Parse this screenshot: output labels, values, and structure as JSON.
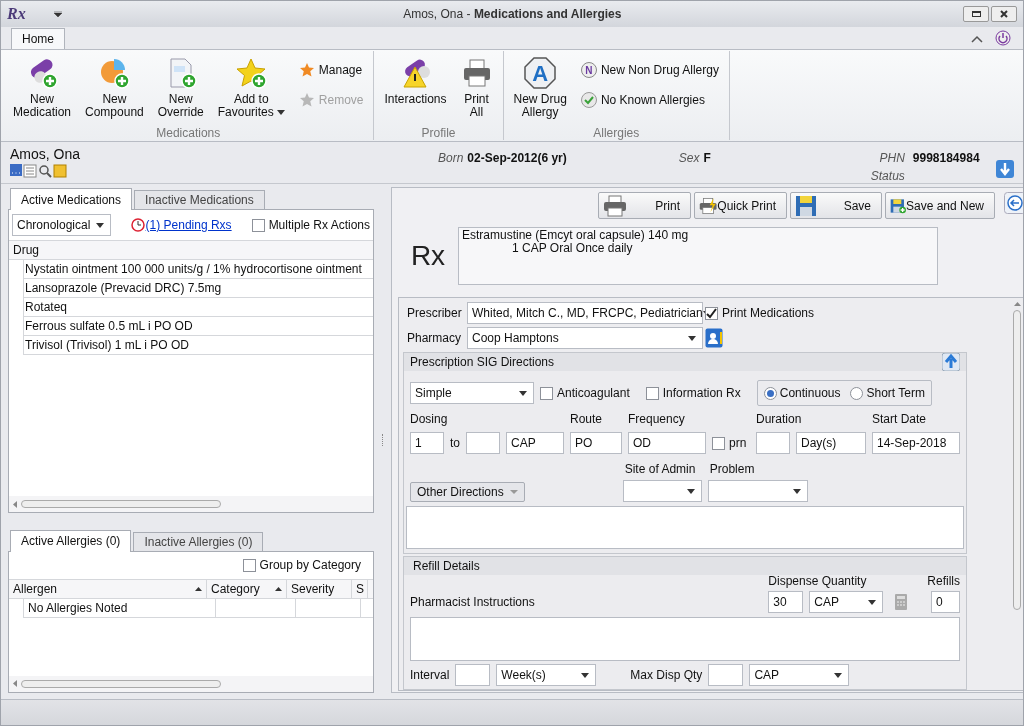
{
  "window": {
    "logo": "Rx",
    "title": "Amos, Ona - **Medications and Allergies**"
  },
  "ribbon": {
    "tabs": [
      {
        "label": "Home",
        "selected": true
      }
    ],
    "groups": [
      {
        "label": "Medications",
        "items": [
          {
            "kind": "large",
            "lines": [
              "New",
              "Medication"
            ]
          },
          {
            "kind": "large",
            "lines": [
              "New",
              "Compound"
            ]
          },
          {
            "kind": "large",
            "lines": [
              "New",
              "Override"
            ]
          },
          {
            "kind": "large",
            "lines": [
              "Add to",
              "Favourites"
            ],
            "dropdown": true
          },
          {
            "kind": "small",
            "label": "Manage",
            "disabled": false
          },
          {
            "kind": "small",
            "label": "Remove",
            "disabled": true
          }
        ]
      },
      {
        "label": "Profile",
        "items": [
          {
            "kind": "large",
            "lines": [
              "Interactions"
            ]
          },
          {
            "kind": "large",
            "lines": [
              "Print",
              "All"
            ]
          }
        ]
      },
      {
        "label": "Allergies",
        "items": [
          {
            "kind": "large",
            "lines": [
              "New Drug",
              "Allergy"
            ],
            "badge": "A"
          },
          {
            "kind": "small",
            "label": "New Non Drug Allergy",
            "badge": "N",
            "disabled": false
          },
          {
            "kind": "small",
            "label": "No Known Allergies",
            "disabled": false
          }
        ]
      }
    ]
  },
  "patient": {
    "name": "Amos, Ona",
    "born_label": "Born",
    "born": "02-Sep-2012(6 yr)",
    "sex_label": "Sex",
    "sex": "F",
    "phn_label": "PHN",
    "phn": "9998184984",
    "status_label": "Status"
  },
  "medications": {
    "tabs": [
      {
        "label": "Active Medications",
        "selected": true
      },
      {
        "label": "Inactive Medications",
        "selected": false
      }
    ],
    "sort": "Chronological",
    "pending_link": "(1) Pending Rxs",
    "multiple_rx": {
      "label": "Multiple Rx Actions",
      "checked": false
    },
    "columns": [
      "Drug"
    ],
    "rows": [
      "Nystatin ointment 100 000 units/g / 1% hydrocortisone ointment",
      "Lansoprazole (Prevacid DRC) 7.5mg",
      "Rotateq",
      "Ferrous sulfate 0.5 mL i PO OD",
      "Trivisol (Trivisol) 1 mL i PO OD"
    ]
  },
  "allergies": {
    "tabs": [
      {
        "label": "Active Allergies (0)",
        "selected": true
      },
      {
        "label": "Inactive Allergies (0)",
        "selected": false
      }
    ],
    "group_by": {
      "label": "Group by Category",
      "checked": false
    },
    "columns": [
      {
        "label": "Allergen",
        "sorted": true
      },
      {
        "label": "Category",
        "sorted": true
      },
      {
        "label": "Severity"
      },
      {
        "label": "S"
      }
    ],
    "rows": [
      {
        "allergen": "No Allergies Noted"
      }
    ]
  },
  "rx": {
    "toolbar": [
      {
        "label": "Print"
      },
      {
        "label": "Quick Print"
      },
      {
        "label": "Save"
      },
      {
        "label": "Save and New"
      }
    ],
    "logo": "Rx",
    "lines": [
      "Estramustine (Emcyt oral capsule) 140 mg",
      "1 CAP Oral Once daily"
    ],
    "prescriber_label": "Prescriber",
    "prescriber": "Whited, Mitch C., MD, FRCPC, Pediatrician",
    "print_medications": {
      "label": "Print Medications",
      "checked": true
    },
    "pharmacy_label": "Pharmacy",
    "pharmacy": "Coop Hamptons",
    "sig": {
      "title": "Prescription SIG Directions",
      "type": "Simple",
      "checks": [
        {
          "label": "Anticoagulant",
          "checked": false
        },
        {
          "label": "Information Rx",
          "checked": false
        }
      ],
      "terms": [
        {
          "label": "Continuous",
          "selected": true
        },
        {
          "label": "Short Term",
          "selected": false
        }
      ],
      "dosing_label": "Dosing",
      "dose": "1",
      "to_label": "to",
      "unit": "CAP",
      "route_label": "Route",
      "route": "PO",
      "frequency_label": "Frequency",
      "frequency": "OD",
      "prn": {
        "label": "prn",
        "checked": false
      },
      "duration_label": "Duration",
      "duration_unit": "Day(s)",
      "start_label": "Start Date",
      "start": "14-Sep-2018",
      "other_directions": "Other Directions",
      "site_label": "Site of Admin",
      "problem_label": "Problem"
    },
    "refill": {
      "title": "Refill Details",
      "dispense_label": "Dispense Quantity",
      "dispense": "30",
      "dispense_unit": "CAP",
      "refills_label": "Refills",
      "refills": "0",
      "instructions_label": "Pharmacist Instructions",
      "interval_label": "Interval",
      "interval_unit": "Week(s)",
      "max_label": "Max Disp Qty",
      "max_unit": "CAP"
    }
  }
}
